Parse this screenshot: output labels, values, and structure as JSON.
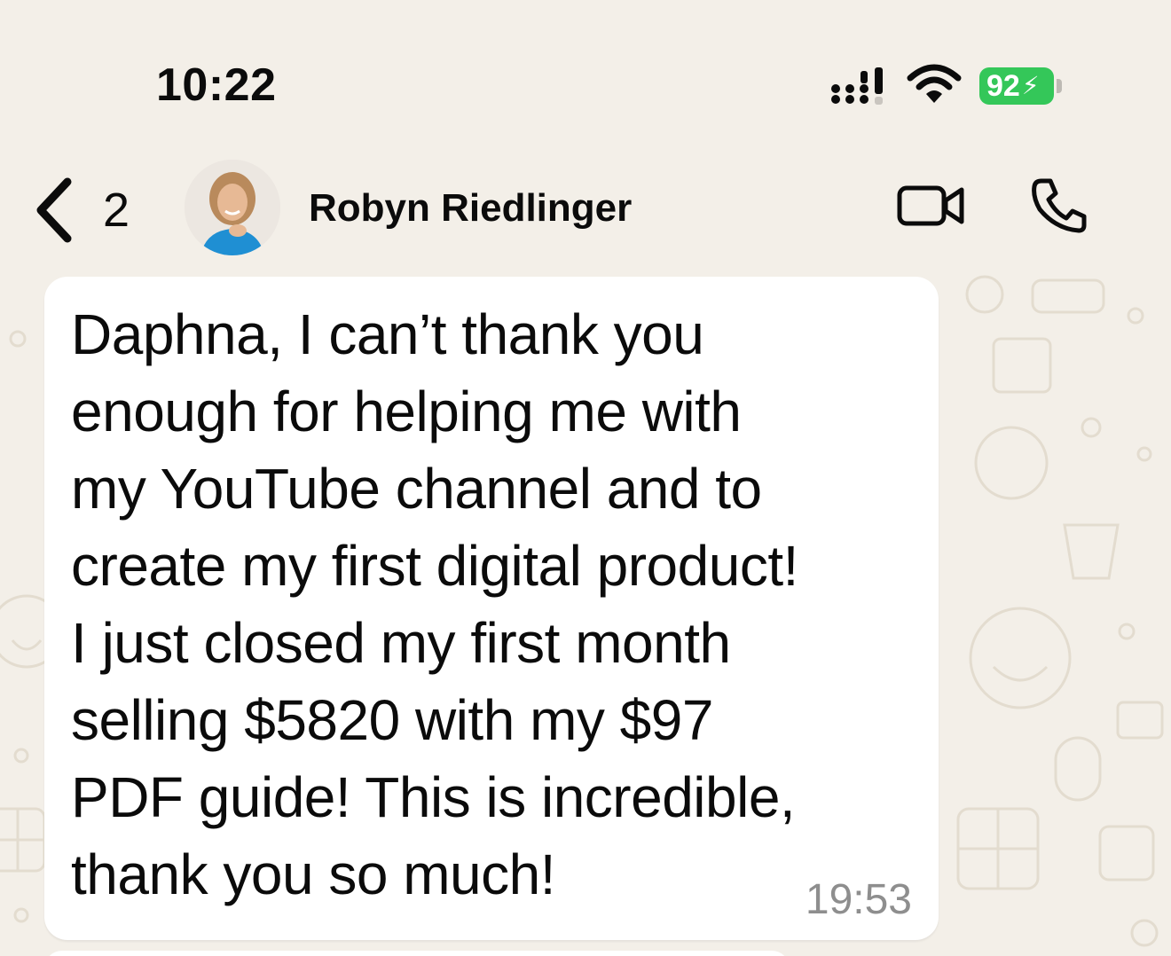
{
  "status_bar": {
    "time": "10:22",
    "battery_level": "92",
    "battery_color": "#34c759",
    "signal_icon": "cellular-signal-icon",
    "wifi_icon": "wifi-icon"
  },
  "header": {
    "back_icon": "chevron-left-icon",
    "unread_count": "2",
    "contact_name": "Robyn Riedlinger",
    "video_icon": "video-camera-icon",
    "call_icon": "phone-icon"
  },
  "message": {
    "text": "Daphna, I can’t thank you\nenough for helping me with\nmy YouTube channel and to\ncreate my first digital product!\nI just closed my first month\nselling $5820 with my $97\nPDF guide! This is incredible,\nthank you so much!",
    "time": "19:53"
  },
  "colors": {
    "background": "#f3efe8",
    "bubble": "#ffffff",
    "timestamp": "#8e8e8e"
  }
}
